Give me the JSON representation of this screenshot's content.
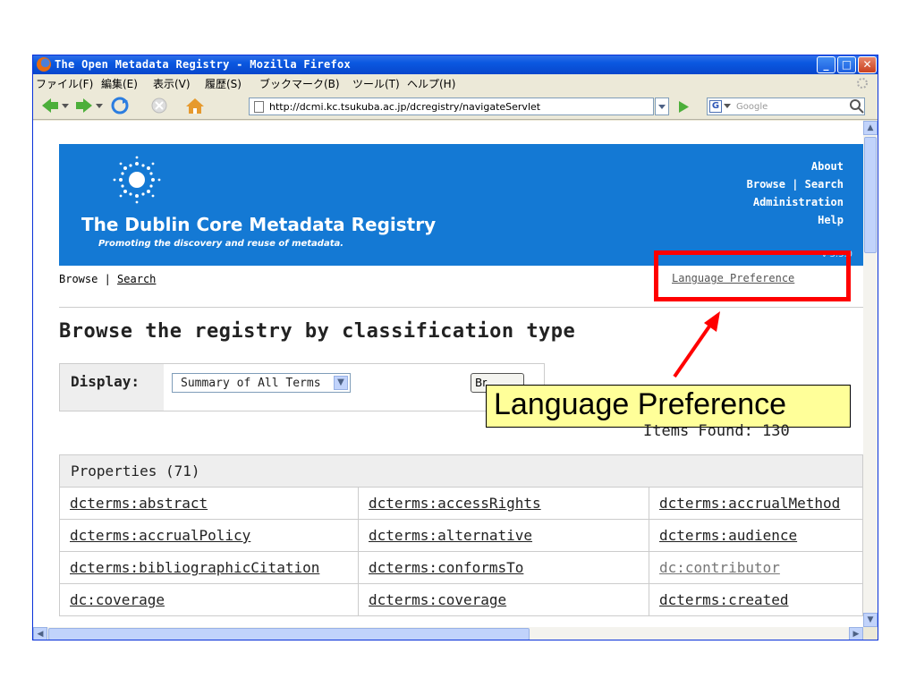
{
  "window": {
    "title": "The Open Metadata Registry - Mozilla Firefox",
    "controls": {
      "minimize": "_",
      "maximize": "□",
      "close": "✕"
    }
  },
  "menu": [
    "ファイル(F)",
    "編集(E)",
    "表示(V)",
    "履歴(S)",
    "ブックマーク(B)",
    "ツール(T)",
    "ヘルプ(H)"
  ],
  "toolbar": {
    "url": "http://dcmi.kc.tsukuba.ac.jp/dcregistry/navigateServlet",
    "search_placeholder": "Google",
    "search_engine": "G"
  },
  "banner": {
    "title": "The Dublin Core Metadata Registry",
    "tagline": "Promoting the discovery and reuse of metadata.",
    "nav": [
      "About",
      "Browse | Search",
      "Administration",
      "Help"
    ],
    "version": "v 3.3.0"
  },
  "breadcrumb": {
    "browse": "Browse",
    "separator": " | ",
    "search": "Search"
  },
  "language_preference": "Language Preference",
  "page_heading": "Browse the registry by classification type",
  "display": {
    "label": "Display:",
    "selected": "Summary of All Terms",
    "button": "Br"
  },
  "callout": "Language Preference",
  "items_found": "Items Found:  130",
  "properties": {
    "header": "Properties (71)",
    "rows": [
      [
        "dcterms:abstract",
        "dcterms:accessRights",
        "dcterms:accrualMethod"
      ],
      [
        "dcterms:accrualPolicy",
        "dcterms:alternative",
        "dcterms:audience"
      ],
      [
        "dcterms:bibliographicCitation",
        "dcterms:conformsTo",
        "dc:contributor"
      ],
      [
        "dc:coverage",
        "dcterms:coverage",
        "dcterms:created"
      ]
    ]
  },
  "colors": {
    "banner": "#1479d4",
    "callout": "#ffff99",
    "highlight": "#ff0000"
  }
}
